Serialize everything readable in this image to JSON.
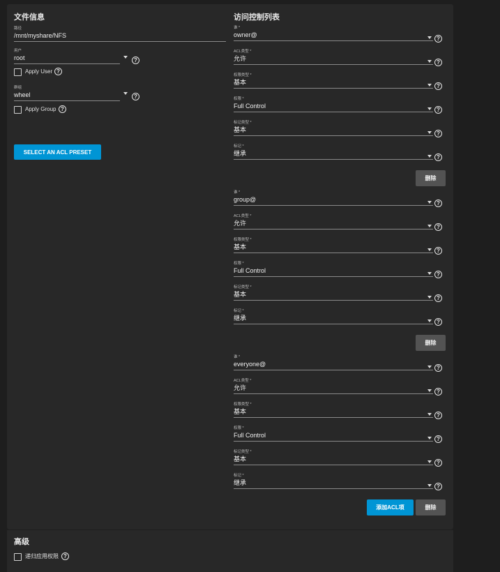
{
  "file_info": {
    "title": "文件信息",
    "path_label": "路径",
    "path_value": "/mnt/myshare/NFS",
    "user_label": "用户",
    "user_value": "root",
    "apply_user_label": "Apply User",
    "group_label": "群组",
    "group_value": "wheel",
    "apply_group_label": "Apply Group",
    "preset_button": "SELECT AN ACL PRESET"
  },
  "acl": {
    "title": "访问控制列表",
    "labels": {
      "who": "谁 *",
      "acl_type": "ACL类型 *",
      "perm_type": "权限类型 *",
      "perm": "权限 *",
      "flag_type": "标记类型 *",
      "flag": "标记 *"
    },
    "entries": [
      {
        "who": "owner@",
        "acl_type": "允许",
        "perm_type": "基本",
        "perm": "Full Control",
        "flag_type": "基本",
        "flag": "继承"
      },
      {
        "who": "group@",
        "acl_type": "允许",
        "perm_type": "基本",
        "perm": "Full Control",
        "flag_type": "基本",
        "flag": "继承"
      },
      {
        "who": "everyone@",
        "acl_type": "允许",
        "perm_type": "基本",
        "perm": "Full Control",
        "flag_type": "基本",
        "flag": "继承"
      }
    ],
    "delete_label": "删除",
    "add_label": "添加ACL项"
  },
  "advanced": {
    "title": "高级",
    "recursive_label": "递归应用权限"
  },
  "icons": {
    "help": "help-circle-icon",
    "dropdown": "dropdown-arrow-icon",
    "checkbox": "checkbox-icon"
  },
  "colors": {
    "page_bg": "#1e1e1e",
    "card_bg": "#282828",
    "primary": "#0095d5",
    "secondary_button": "#535353"
  }
}
